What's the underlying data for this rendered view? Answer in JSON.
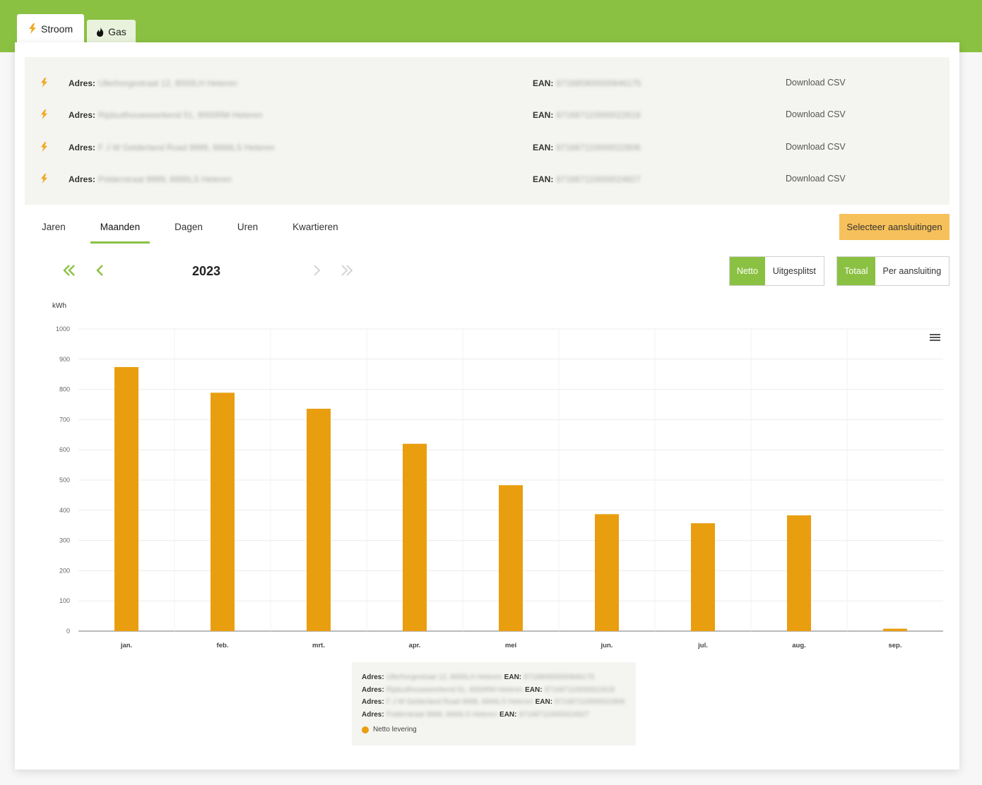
{
  "tabs": [
    {
      "label": "Stroom",
      "icon": "lightning-icon",
      "active": true
    },
    {
      "label": "Gas",
      "icon": "flame-icon",
      "active": false
    }
  ],
  "connections": [
    {
      "adres_label": "Adres:",
      "adres": "Ullerhorgestraat 12, 8000LH Heteren",
      "ean_label": "EAN:",
      "ean": "871685900000846175",
      "download": "Download CSV"
    },
    {
      "adres_label": "Adres:",
      "adres": "Rijdsuithouwseerkend 51, 9000RM Heteren",
      "ean_label": "EAN:",
      "ean": "871687110000022618",
      "download": "Download CSV"
    },
    {
      "adres_label": "Adres:",
      "adres": "F J W Gelderland Road 9999, 6666LS Heteren",
      "ean_label": "EAN:",
      "ean": "871687110000022806",
      "download": "Download CSV"
    },
    {
      "adres_label": "Adres:",
      "adres": "Polderstraat 9999, 6666LS Heteren",
      "ean_label": "EAN:",
      "ean": "871687110000024927",
      "download": "Download CSV"
    }
  ],
  "periods": [
    {
      "label": "Jaren",
      "active": false
    },
    {
      "label": "Maanden",
      "active": true
    },
    {
      "label": "Dagen",
      "active": false
    },
    {
      "label": "Uren",
      "active": false
    },
    {
      "label": "Kwartieren",
      "active": false
    }
  ],
  "select_button": "Selecteer aansluitingen",
  "year": "2023",
  "toggle_mode": [
    {
      "label": "Netto",
      "on": true
    },
    {
      "label": "Uitgesplitst",
      "on": false
    }
  ],
  "toggle_group": [
    {
      "label": "Totaal",
      "on": true
    },
    {
      "label": "Per aansluiting",
      "on": false
    }
  ],
  "colors": {
    "brand_green": "#8bc142",
    "bar": "#e99e10",
    "select_button": "#f6c05a"
  },
  "chart_data": {
    "type": "bar",
    "ylabel": "kWh",
    "ylim": [
      0,
      1000
    ],
    "yticks": [
      0,
      100,
      200,
      300,
      400,
      500,
      600,
      700,
      800,
      900,
      1000
    ],
    "categories": [
      "jan.",
      "feb.",
      "mrt.",
      "apr.",
      "mei",
      "jun.",
      "jul.",
      "aug.",
      "sep."
    ],
    "series": [
      {
        "name": "Netto levering",
        "values": [
          874,
          789,
          736,
          620,
          483,
          387,
          357,
          383,
          8
        ]
      }
    ],
    "grid": true,
    "legend": "bottom-center"
  },
  "legend_rows": [
    {
      "adres_label": "Adres:",
      "adres": "Ullerhorgestraat 12, 8000LH Heteren",
      "ean_label": "EAN:",
      "ean": "871685900000846175"
    },
    {
      "adres_label": "Adres:",
      "adres": "Rijdsuithouwseerkend 51, 9000RM Heteren",
      "ean_label": "EAN:",
      "ean": "871687110000022618"
    },
    {
      "adres_label": "Adres:",
      "adres": "F J W Gelderland Road 9999, 6666LS Heteren",
      "ean_label": "EAN:",
      "ean": "871687110000022806"
    },
    {
      "adres_label": "Adres:",
      "adres": "Polderstraat 9999, 6666LS Heteren",
      "ean_label": "EAN:",
      "ean": "871687110000024927"
    }
  ]
}
